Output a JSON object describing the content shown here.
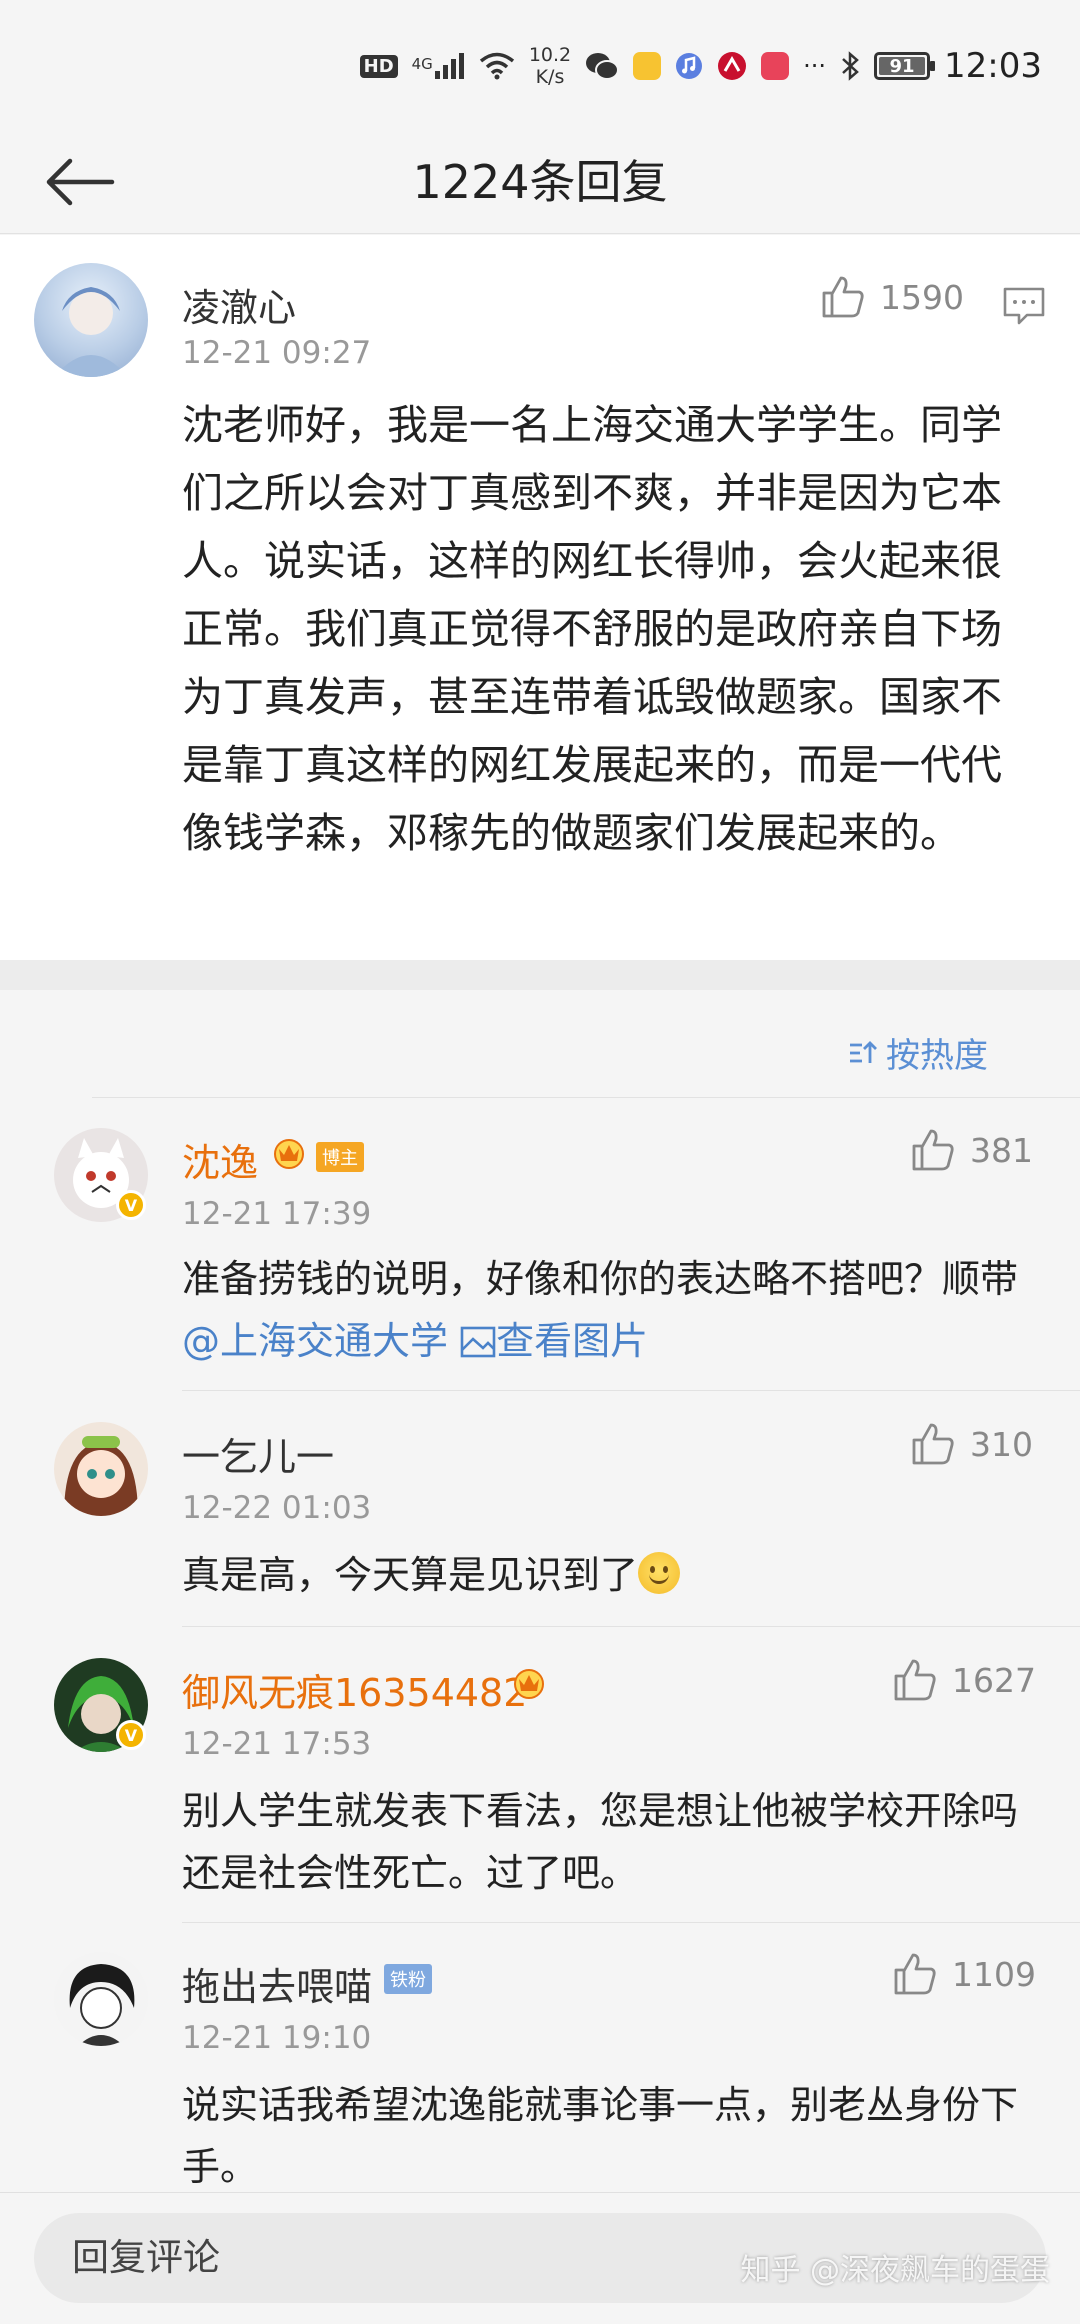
{
  "status_bar": {
    "hd": "HD",
    "network": "4G",
    "speed_value": "10.2",
    "speed_unit": "K/s",
    "more": "···",
    "battery": "91",
    "time": "12:03",
    "icons": [
      "signal-icon",
      "wifi-icon",
      "wechat-icon",
      "app-icon",
      "music-icon",
      "bank-icon",
      "app-icon",
      "bluetooth-icon"
    ]
  },
  "header": {
    "title": "1224条回复"
  },
  "post": {
    "author": "凌澈心",
    "time": "12-21 09:27",
    "likes": "1590",
    "text": "沈老师好，我是一名上海交通大学学生。同学们之所以会对丁真感到不爽，并非是因为它本人。说实话，这样的网红长得帅，会火起来很正常。我们真正觉得不舒服的是政府亲自下场为丁真发声，甚至连带着诋毁做题家。国家不是靠丁真这样的网红发展起来的，而是一代代像钱学森，邓稼先的做题家们发展起来的。"
  },
  "sort": {
    "label": "按热度"
  },
  "replies": [
    {
      "author": "沈逸",
      "badge": "博主",
      "time": "12-21 17:39",
      "likes": "381",
      "text_before": "准备捞钱的说明，好像和你的表达略不搭吧？顺带",
      "mention": "@上海交通大学",
      "view_image": "查看图片"
    },
    {
      "author": "一乞儿一",
      "time": "12-22 01:03",
      "likes": "310",
      "text": "真是高，今天算是见识到了"
    },
    {
      "author": "御风无痕16354482",
      "time": "12-21 17:53",
      "likes": "1627",
      "text": "别人学生就发表下看法，您是想让他被学校开除吗还是社会性死亡。过了吧。"
    },
    {
      "author": "拖出去喂喵",
      "badge": "铁粉",
      "time": "12-21 19:10",
      "likes": "1109",
      "text": "说实话我希望沈逸能就事论事一点，别老丛身份下手。"
    }
  ],
  "reply_bar": {
    "placeholder": "回复评论"
  },
  "watermark": "知乎 @深夜飙车的蛋蛋",
  "colors": {
    "accent_blue": "#4a82c9",
    "vip_orange": "#e8700d",
    "background": "#f5f5f5"
  }
}
